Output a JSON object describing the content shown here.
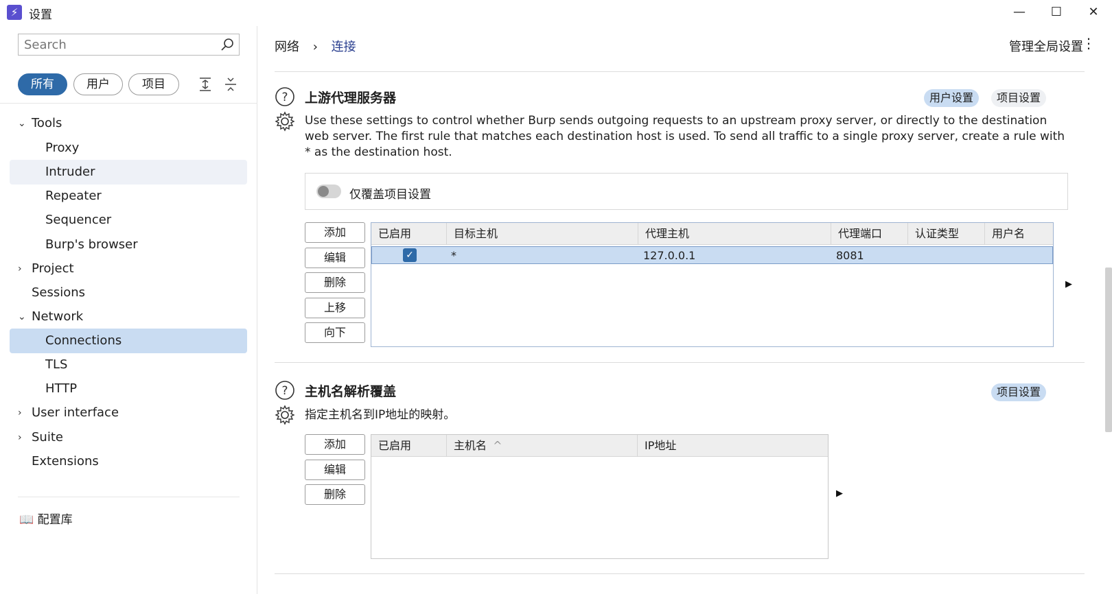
{
  "window": {
    "title": "设置",
    "minimize": "—",
    "maximize": "☐",
    "close": "✕"
  },
  "sidebar": {
    "search_placeholder": "Search",
    "filters": [
      "所有",
      "用户",
      "项目"
    ],
    "tree": [
      {
        "label": "Tools",
        "chev": "⌄"
      },
      {
        "label": "Proxy"
      },
      {
        "label": "Intruder"
      },
      {
        "label": "Repeater"
      },
      {
        "label": "Sequencer"
      },
      {
        "label": "Burp's browser"
      },
      {
        "label": "Project",
        "chev": "›"
      },
      {
        "label": "Sessions"
      },
      {
        "label": "Network",
        "chev": "⌄"
      },
      {
        "label": "Connections"
      },
      {
        "label": "TLS"
      },
      {
        "label": "HTTP"
      },
      {
        "label": "User interface",
        "chev": "›"
      },
      {
        "label": "Suite",
        "chev": "›"
      },
      {
        "label": "Extensions"
      }
    ],
    "library": "配置库"
  },
  "header": {
    "breadcrumb_root": "网络",
    "breadcrumb_sep": "›",
    "breadcrumb_current": "连接",
    "global_settings": "管理全局设置",
    "kebab": "⋮"
  },
  "upstream": {
    "title": "上游代理服务器",
    "tag_user": "用户设置",
    "tag_project": "项目设置",
    "description": "Use these settings to control whether Burp sends outgoing requests to an upstream proxy server, or directly to the destination web server. The first rule that matches each destination host is used. To send all traffic to a single proxy server, create a rule with * as the destination host.",
    "override_label": "仅覆盖项目设置",
    "buttons": [
      "添加",
      "编辑",
      "删除",
      "上移",
      "向下"
    ],
    "columns": [
      "已启用",
      "目标主机",
      "代理主机",
      "代理端口",
      "认证类型",
      "用户名"
    ],
    "rows": [
      {
        "enabled": "✓",
        "target": "*",
        "proxy_host": "127.0.0.1",
        "proxy_port": "8081",
        "auth": "",
        "user": ""
      }
    ]
  },
  "hostname": {
    "title": "主机名解析覆盖",
    "tag_project": "项目设置",
    "description": "指定主机名到IP地址的映射。",
    "buttons": [
      "添加",
      "编辑",
      "删除"
    ],
    "columns": [
      "已启用",
      "主机名",
      "IP地址"
    ],
    "sort_indicator": "^"
  },
  "colors": {
    "accent": "#2e6aa8",
    "selection": "#c9dcf2",
    "app_icon": "#5a4fcf"
  }
}
